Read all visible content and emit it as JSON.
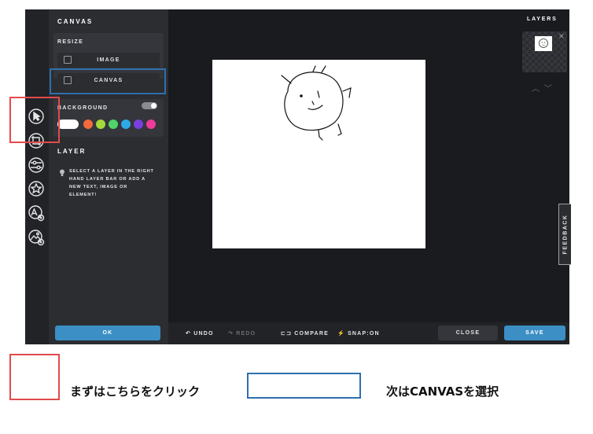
{
  "panel": {
    "title": "CANVAS",
    "resize_label": "RESIZE",
    "image_button": "IMAGE",
    "canvas_button": "CANVAS",
    "background_label": "BACKGROUND",
    "background_toggle_on": true,
    "background_colors": [
      "#ffffff",
      "#f26a3d",
      "#a4d93a",
      "#4fd36a",
      "#2fa8e8",
      "#7a3fe0",
      "#ef3a9a"
    ],
    "layer_title": "LAYER",
    "layer_hint": "SELECT A LAYER IN THE RIGHT HAND LAYER BAR OR ADD A NEW TEXT, IMAGE OR ELEMENT!",
    "ok_button": "OK"
  },
  "toolbar_icons": [
    "cursor-select-icon",
    "crop-icon",
    "adjust-sliders-icon",
    "badge-icon",
    "text-shapes-icon",
    "add-image-icon"
  ],
  "layers": {
    "title": "LAYERS"
  },
  "feedback_tab": "FEEDBACK",
  "bottom_bar": {
    "undo": "UNDO",
    "redo": "REDO",
    "compare": "COMPARE",
    "snap": "SNAP:ON",
    "close": "CLOSE",
    "save": "SAVE"
  },
  "legend": {
    "step1": "まずはこちらをクリック",
    "step2": "次はCANVASを選択"
  },
  "colors": {
    "accent": "#3b8fc4",
    "highlight_red": "#e24b4b",
    "highlight_blue": "#2f6fae"
  }
}
